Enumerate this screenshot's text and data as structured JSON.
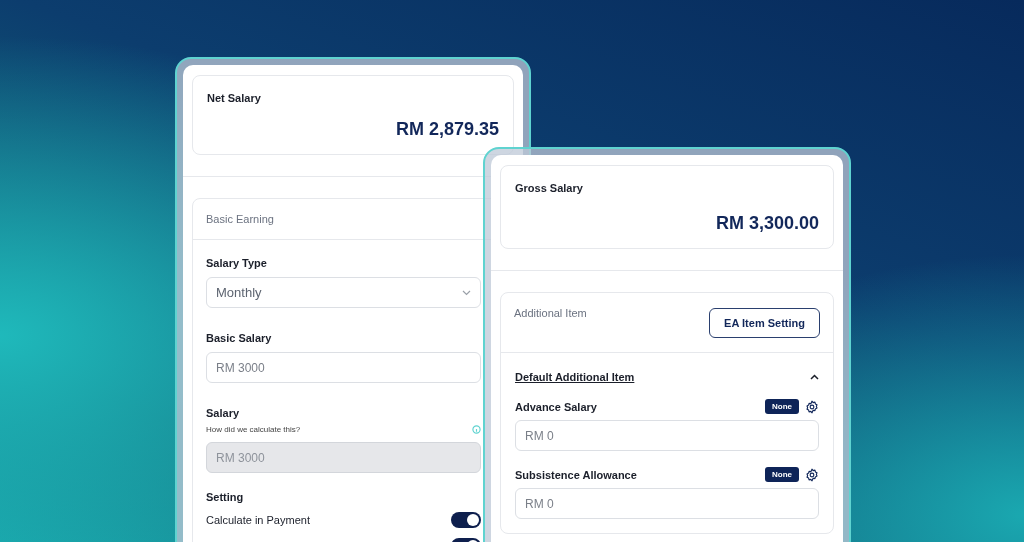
{
  "net_salary": {
    "label": "Net Salary",
    "amount": "RM 2,879.35"
  },
  "basic_earning": {
    "title": "Basic Earning",
    "fields": [
      {
        "kind": "select",
        "label": "Salary Type",
        "value": "Monthly"
      },
      {
        "kind": "input",
        "label": "Basic Salary",
        "value": "RM 3000",
        "disabled": false
      },
      {
        "kind": "input",
        "label": "Salary",
        "hint": "How did we calculate this?",
        "value": "RM 3000",
        "disabled": true
      }
    ],
    "setting": {
      "title": "Setting",
      "toggles": [
        {
          "label": "Calculate in Payment",
          "on": true
        },
        {
          "on": true
        }
      ]
    }
  },
  "gross_salary": {
    "label": "Gross Salary",
    "amount": "RM 3,300.00"
  },
  "additional": {
    "title": "Additional Item",
    "button": "EA Item Setting",
    "section": {
      "title": "Default Additional Item",
      "expanded": true,
      "items": [
        {
          "label": "Advance Salary",
          "badge": "None",
          "value": "RM 0"
        },
        {
          "label": "Subsistence Allowance",
          "badge": "None",
          "value": "RM 0"
        }
      ]
    }
  }
}
